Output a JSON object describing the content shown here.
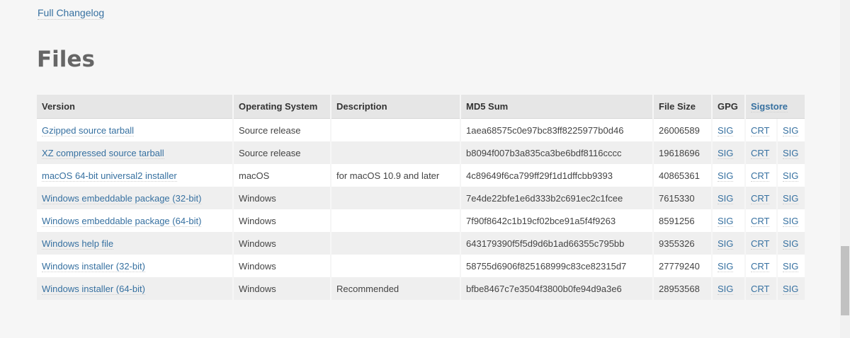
{
  "changelog_link": "Full Changelog",
  "section_title": "Files",
  "table": {
    "headers": {
      "version": "Version",
      "os": "Operating System",
      "description": "Description",
      "md5": "MD5 Sum",
      "size": "File Size",
      "gpg": "GPG",
      "sigstore": "Sigstore"
    },
    "rows": [
      {
        "version": "Gzipped source tarball",
        "os": "Source release",
        "description": "",
        "md5": "1aea68575c0e97bc83ff8225977b0d46",
        "size": "26006589",
        "gpg": "SIG",
        "crt": "CRT",
        "sig": "SIG"
      },
      {
        "version": "XZ compressed source tarball",
        "os": "Source release",
        "description": "",
        "md5": "b8094f007b3a835ca3be6bdf8116cccc",
        "size": "19618696",
        "gpg": "SIG",
        "crt": "CRT",
        "sig": "SIG"
      },
      {
        "version": "macOS 64-bit universal2 installer",
        "os": "macOS",
        "description": "for macOS 10.9 and later",
        "md5": "4c89649f6ca799ff29f1d1dffcbb9393",
        "size": "40865361",
        "gpg": "SIG",
        "crt": "CRT",
        "sig": "SIG"
      },
      {
        "version": "Windows embeddable package (32-bit)",
        "os": "Windows",
        "description": "",
        "md5": "7e4de22bfe1e6d333b2c691ec2c1fcee",
        "size": "7615330",
        "gpg": "SIG",
        "crt": "CRT",
        "sig": "SIG"
      },
      {
        "version": "Windows embeddable package (64-bit)",
        "os": "Windows",
        "description": "",
        "md5": "7f90f8642c1b19cf02bce91a5f4f9263",
        "size": "8591256",
        "gpg": "SIG",
        "crt": "CRT",
        "sig": "SIG"
      },
      {
        "version": "Windows help file",
        "os": "Windows",
        "description": "",
        "md5": "643179390f5f5d9d6b1ad66355c795bb",
        "size": "9355326",
        "gpg": "SIG",
        "crt": "CRT",
        "sig": "SIG"
      },
      {
        "version": "Windows installer (32-bit)",
        "os": "Windows",
        "description": "",
        "md5": "58755d6906f825168999c83ce82315d7",
        "size": "27779240",
        "gpg": "SIG",
        "crt": "CRT",
        "sig": "SIG"
      },
      {
        "version": "Windows installer (64-bit)",
        "os": "Windows",
        "description": "Recommended",
        "md5": "bfbe8467c7e3504f3800b0fe94d9a3e6",
        "size": "28953568",
        "gpg": "SIG",
        "crt": "CRT",
        "sig": "SIG"
      }
    ]
  },
  "colors": {
    "link": "#3670a0",
    "background": "#f6f6f6",
    "header_bg": "#e6e6e6",
    "title": "#666666"
  }
}
